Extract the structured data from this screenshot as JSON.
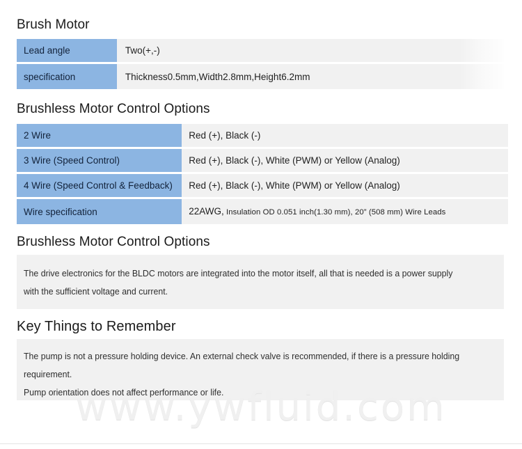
{
  "sections": {
    "brush_motor": {
      "heading": "Brush Motor",
      "rows": [
        {
          "label": "Lead angle",
          "value": "Two(+,-)"
        },
        {
          "label": "specification",
          "value": "Thickness0.5mm,Width2.8mm,Height6.2mm"
        }
      ]
    },
    "brushless_table": {
      "heading": "Brushless Motor Control Options",
      "rows": [
        {
          "label": "2 Wire",
          "value": "Red (+), Black (-)"
        },
        {
          "label": "3 Wire (Speed Control)",
          "value": "Red (+), Black (-), White (PWM) or Yellow (Analog)"
        },
        {
          "label": "4 Wire (Speed Control & Feedback)",
          "value": "Red (+), Black (-), White (PWM) or Yellow (Analog)"
        },
        {
          "label": "Wire specification",
          "value_primary": "22AWG,",
          "value_secondary": " Insulation OD 0.051 inch(1.30 mm), 20” (508 mm) Wire Leads"
        }
      ]
    },
    "brushless_note": {
      "heading": "Brushless Motor Control Options",
      "paragraph": "The drive electronics for the BLDC motors are integrated into the motor itself, all that is needed is a power supply with the sufficient voltage and current."
    },
    "key_things": {
      "heading": "Key Things to Remember",
      "paragraphs": [
        "The pump is not a pressure holding device. An external check valve is recommended, if there is a pressure holding requirement.",
        "Pump orientation does not affect performance or life."
      ]
    }
  },
  "watermark": "www.ywfluid.com",
  "colors": {
    "key_cell": "#8cb5e2",
    "value_cell": "#f1f1f1",
    "panel": "#f1f1f1",
    "text": "#1f1f1f",
    "watermark": "#f0f0f0"
  }
}
